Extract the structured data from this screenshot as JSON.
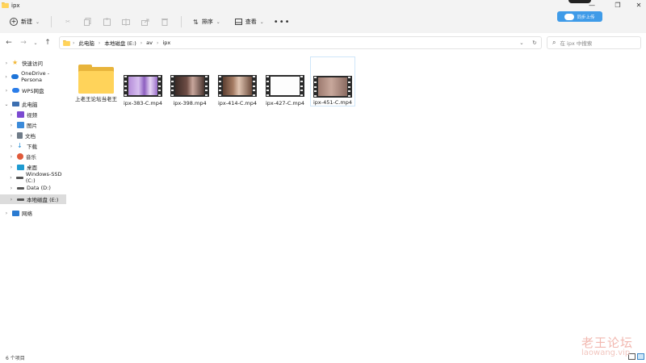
{
  "window": {
    "title": "ipx"
  },
  "toolbar": {
    "new_label": "新建",
    "sort_label": "排序",
    "view_label": "查看",
    "more_label": "•••",
    "cloud_label": "同步上传"
  },
  "address": {
    "crumbs": [
      "此电脑",
      "本地磁盘 (E:)",
      "av",
      "ipx"
    ],
    "search_placeholder": "在 ipx 中搜索"
  },
  "sidebar": {
    "items": [
      {
        "label": "快速访问",
        "icon": "star-icon",
        "color": "#f2b632"
      },
      {
        "label": "OneDrive - Persona",
        "icon": "cloud-icon",
        "color": "#1d74d8"
      },
      {
        "label": "WPS网盘",
        "icon": "wps-cloud-icon",
        "color": "#2b7de9"
      },
      {
        "label": "此电脑",
        "icon": "computer-icon",
        "color": "#3c6fb0"
      },
      {
        "label": "视频",
        "icon": "video-icon",
        "color": "#7b4ad1"
      },
      {
        "label": "图片",
        "icon": "pictures-icon",
        "color": "#3b8ad9"
      },
      {
        "label": "文档",
        "icon": "documents-icon",
        "color": "#6f7b88"
      },
      {
        "label": "下载",
        "icon": "download-icon",
        "color": "#1e8ad6"
      },
      {
        "label": "音乐",
        "icon": "music-icon",
        "color": "#e05a3a"
      },
      {
        "label": "桌面",
        "icon": "desktop-icon",
        "color": "#1f9bd1"
      },
      {
        "label": "Windows-SSD (C:)",
        "icon": "drive-icon",
        "color": "#555555"
      },
      {
        "label": "Data (D:)",
        "icon": "drive-icon",
        "color": "#555555"
      },
      {
        "label": "本地磁盘 (E:)",
        "icon": "drive-icon",
        "color": "#555555"
      },
      {
        "label": "网络",
        "icon": "network-icon",
        "color": "#2a7bd1"
      }
    ]
  },
  "files": [
    {
      "name": "上老王论坛当老王",
      "type": "folder"
    },
    {
      "name": "ipx-383-C.mp4",
      "type": "video"
    },
    {
      "name": "ipx-398.mp4",
      "type": "video"
    },
    {
      "name": "ipx-414-C.mp4",
      "type": "video"
    },
    {
      "name": "ipx-427-C.mp4",
      "type": "video"
    },
    {
      "name": "ipx-451-C.mp4",
      "type": "video"
    }
  ],
  "status": {
    "count": "6 个项目"
  },
  "watermark": {
    "cn": "老王论坛",
    "en": "laowang.vip"
  }
}
